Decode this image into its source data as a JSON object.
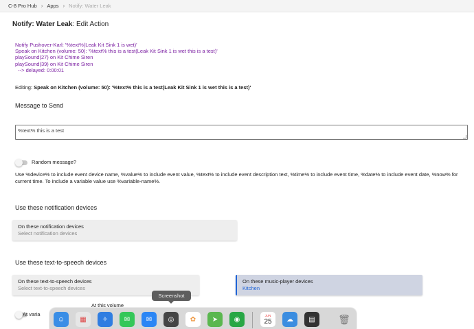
{
  "breadcrumb": [
    "C-8 Pro Hub",
    "Apps",
    "Notify: Water Leak"
  ],
  "title": {
    "app": "Notify: Water Leak",
    "action": "Edit Action"
  },
  "summary": [
    "Notify Pushover-Karl: '%text%(Leak Kit Sink 1 is wet)'",
    "Speak on Kitchen (volume: 50): '%text% this is a test(Leak Kit Sink 1 is wet this is a test)'",
    "playSound(27) on Kit Chime Siren",
    "playSound(39) on Kit Chime Siren",
    "  --> delayed: 0:00:01"
  ],
  "editing": {
    "prefix": "Editing:",
    "text": "Speak on Kitchen (volume: 50): '%text% this is a test(Leak Kit Sink 1 is wet this is a test)'"
  },
  "message": {
    "label": "Message to Send",
    "value": "%text% this is a test"
  },
  "random": {
    "label": "Random message?"
  },
  "help_text": "Use %device% to include event device name, %value% to include event value, %text% to include event description text, %time% to include event time, %date% to include event date, %now% for current time.  To include a variable value use %variable-name%.",
  "notification": {
    "section": "Use these notification devices",
    "select_label": "On these notification devices",
    "placeholder": "Select notification devices"
  },
  "tts": {
    "section": "Use these text-to-speech devices",
    "select_label": "On these text-to-speech devices",
    "placeholder": "Select text-to-speech devices"
  },
  "music": {
    "select_label": "On these music-player devices",
    "value": "Kitchen"
  },
  "volume": {
    "label": "At this volume",
    "toggle_label": "At varia"
  },
  "dock": {
    "tooltip": "Screenshot",
    "calendar_month": "JUN",
    "calendar_day": "25",
    "apps": [
      {
        "name": "finder",
        "color": "#3a8ee6",
        "glyph": "☺"
      },
      {
        "name": "launchpad",
        "color": "#e5e5e5",
        "glyph": "▦"
      },
      {
        "name": "safari",
        "color": "#2f7de1",
        "glyph": "✧"
      },
      {
        "name": "messages",
        "color": "#34c759",
        "glyph": "✉"
      },
      {
        "name": "mail",
        "color": "#2b86f5",
        "glyph": "✉"
      },
      {
        "name": "screenshot",
        "color": "#444444",
        "glyph": "◎"
      },
      {
        "name": "photos",
        "color": "#ffffff",
        "glyph": "✿"
      },
      {
        "name": "maps",
        "color": "#5ab74f",
        "glyph": "➤"
      },
      {
        "name": "find-my",
        "color": "#28a745",
        "glyph": "◉"
      },
      {
        "name": "weather",
        "color": "#3b8de0",
        "glyph": "☁"
      },
      {
        "name": "calculator",
        "color": "#333333",
        "glyph": "▤"
      },
      {
        "name": "trash",
        "color": "#9a9a9a",
        "glyph": "🗑"
      }
    ]
  }
}
